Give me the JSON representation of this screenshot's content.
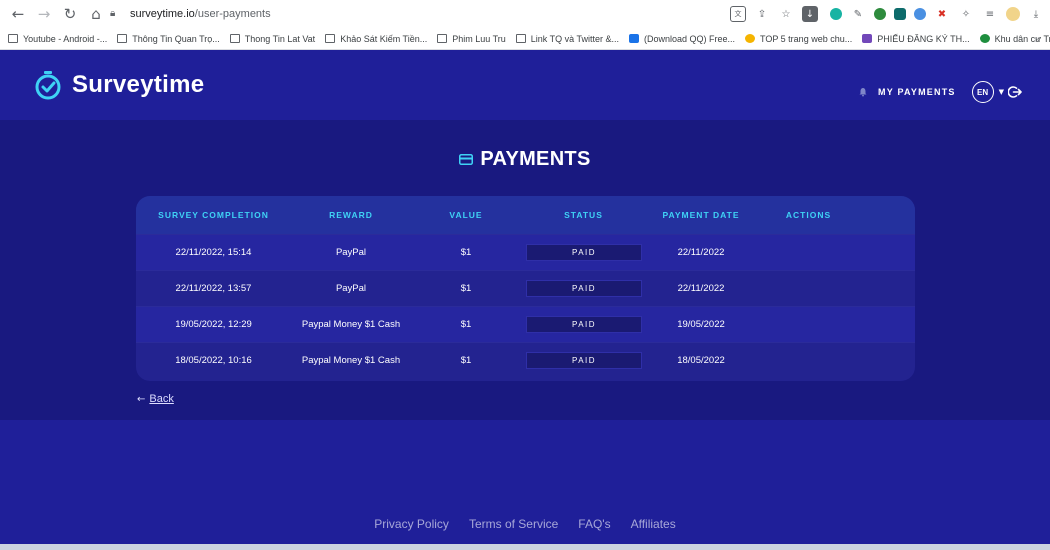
{
  "browser": {
    "url_host": "surveytime.io",
    "url_path": "/user-payments",
    "bookmarks": [
      {
        "label": "Youtube - Android -...",
        "icon": "folder-icon"
      },
      {
        "label": "Thông Tin Quan Trọ...",
        "icon": "folder-icon"
      },
      {
        "label": "Thong Tin Lat Vat",
        "icon": "folder-icon"
      },
      {
        "label": "Khảo Sát Kiếm Tiền...",
        "icon": "folder-icon"
      },
      {
        "label": "Phim Luu Tru",
        "icon": "folder-icon"
      },
      {
        "label": "Link TQ và Twitter &...",
        "icon": "folder-icon"
      },
      {
        "label": "(Download QQ) Free...",
        "icon": "favicon-qq"
      },
      {
        "label": "TOP 5 trang web chu...",
        "icon": "favicon-star"
      },
      {
        "label": "PHIẾU ĐĂNG KÝ TH...",
        "icon": "favicon-forms"
      },
      {
        "label": "Khu dân cư Trường S...",
        "icon": "favicon-green"
      }
    ],
    "more": "»"
  },
  "header": {
    "logo_text": "Surveytime",
    "my_payments": "MY PAYMENTS",
    "language": "EN",
    "accent_color": "#3fd2f5"
  },
  "page": {
    "title": "PAYMENTS"
  },
  "table": {
    "columns": [
      "SURVEY COMPLETION",
      "REWARD",
      "VALUE",
      "STATUS",
      "PAYMENT DATE",
      "ACTIONS"
    ],
    "rows": [
      {
        "completion": "22/11/2022, 15:14",
        "reward": "PayPal",
        "value": "$1",
        "status": "PAID",
        "payment_date": "22/11/2022"
      },
      {
        "completion": "22/11/2022, 13:57",
        "reward": "PayPal",
        "value": "$1",
        "status": "PAID",
        "payment_date": "22/11/2022"
      },
      {
        "completion": "19/05/2022, 12:29",
        "reward": "Paypal Money $1 Cash",
        "value": "$1",
        "status": "PAID",
        "payment_date": "19/05/2022"
      },
      {
        "completion": "18/05/2022, 10:16",
        "reward": "Paypal Money $1 Cash",
        "value": "$1",
        "status": "PAID",
        "payment_date": "18/05/2022"
      }
    ]
  },
  "back": {
    "arrow": "←",
    "label": "Back"
  },
  "footer": {
    "links": [
      "Privacy Policy",
      "Terms of Service",
      "FAQ's",
      "Affiliates"
    ]
  }
}
